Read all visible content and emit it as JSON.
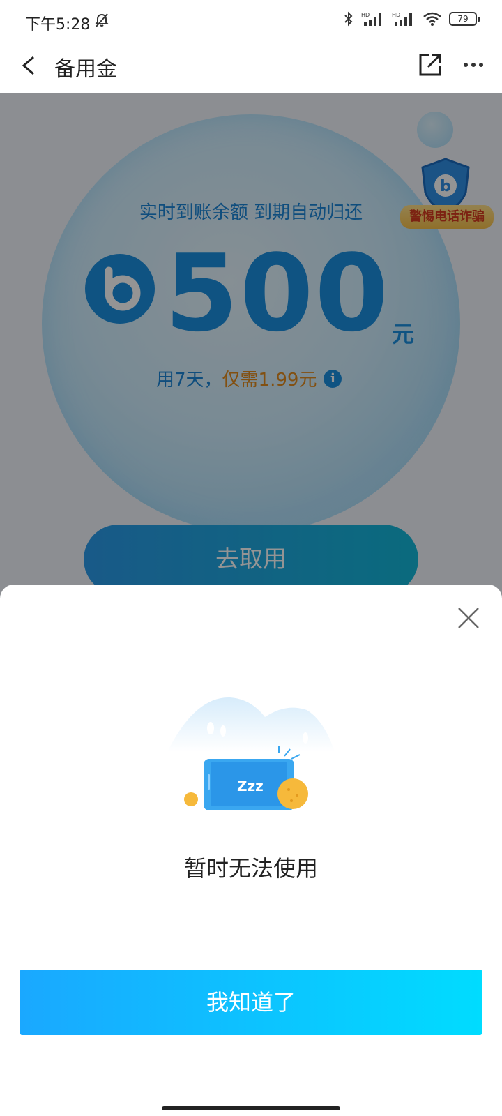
{
  "status_bar": {
    "time": "下午5:28",
    "battery": "79",
    "icons": [
      "bell-off-icon",
      "bluetooth-icon",
      "signal-hd-icon",
      "signal-hd-icon",
      "wifi-icon",
      "battery-icon"
    ]
  },
  "nav": {
    "title": "备用金",
    "back_icon": "chevron-left-icon",
    "share_icon": "share-icon",
    "more_icon": "more-icon"
  },
  "main": {
    "subtitle": "实时到账余额 到期自动归还",
    "amount": "500",
    "unit": "元",
    "fee_prefix": "用7天，",
    "fee_highlight": "仅需1.99元",
    "take_button": "去取用",
    "fraud_tag": "警惕电话诈骗"
  },
  "sheet": {
    "illustration_text": "Zzz",
    "message": "暂时无法使用",
    "confirm_button": "我知道了"
  },
  "colors": {
    "brand_blue": "#1a8fe0",
    "button_gradient_start": "#1aa8ff",
    "button_gradient_end": "#00dcff",
    "fee_orange": "#e08a1e"
  }
}
